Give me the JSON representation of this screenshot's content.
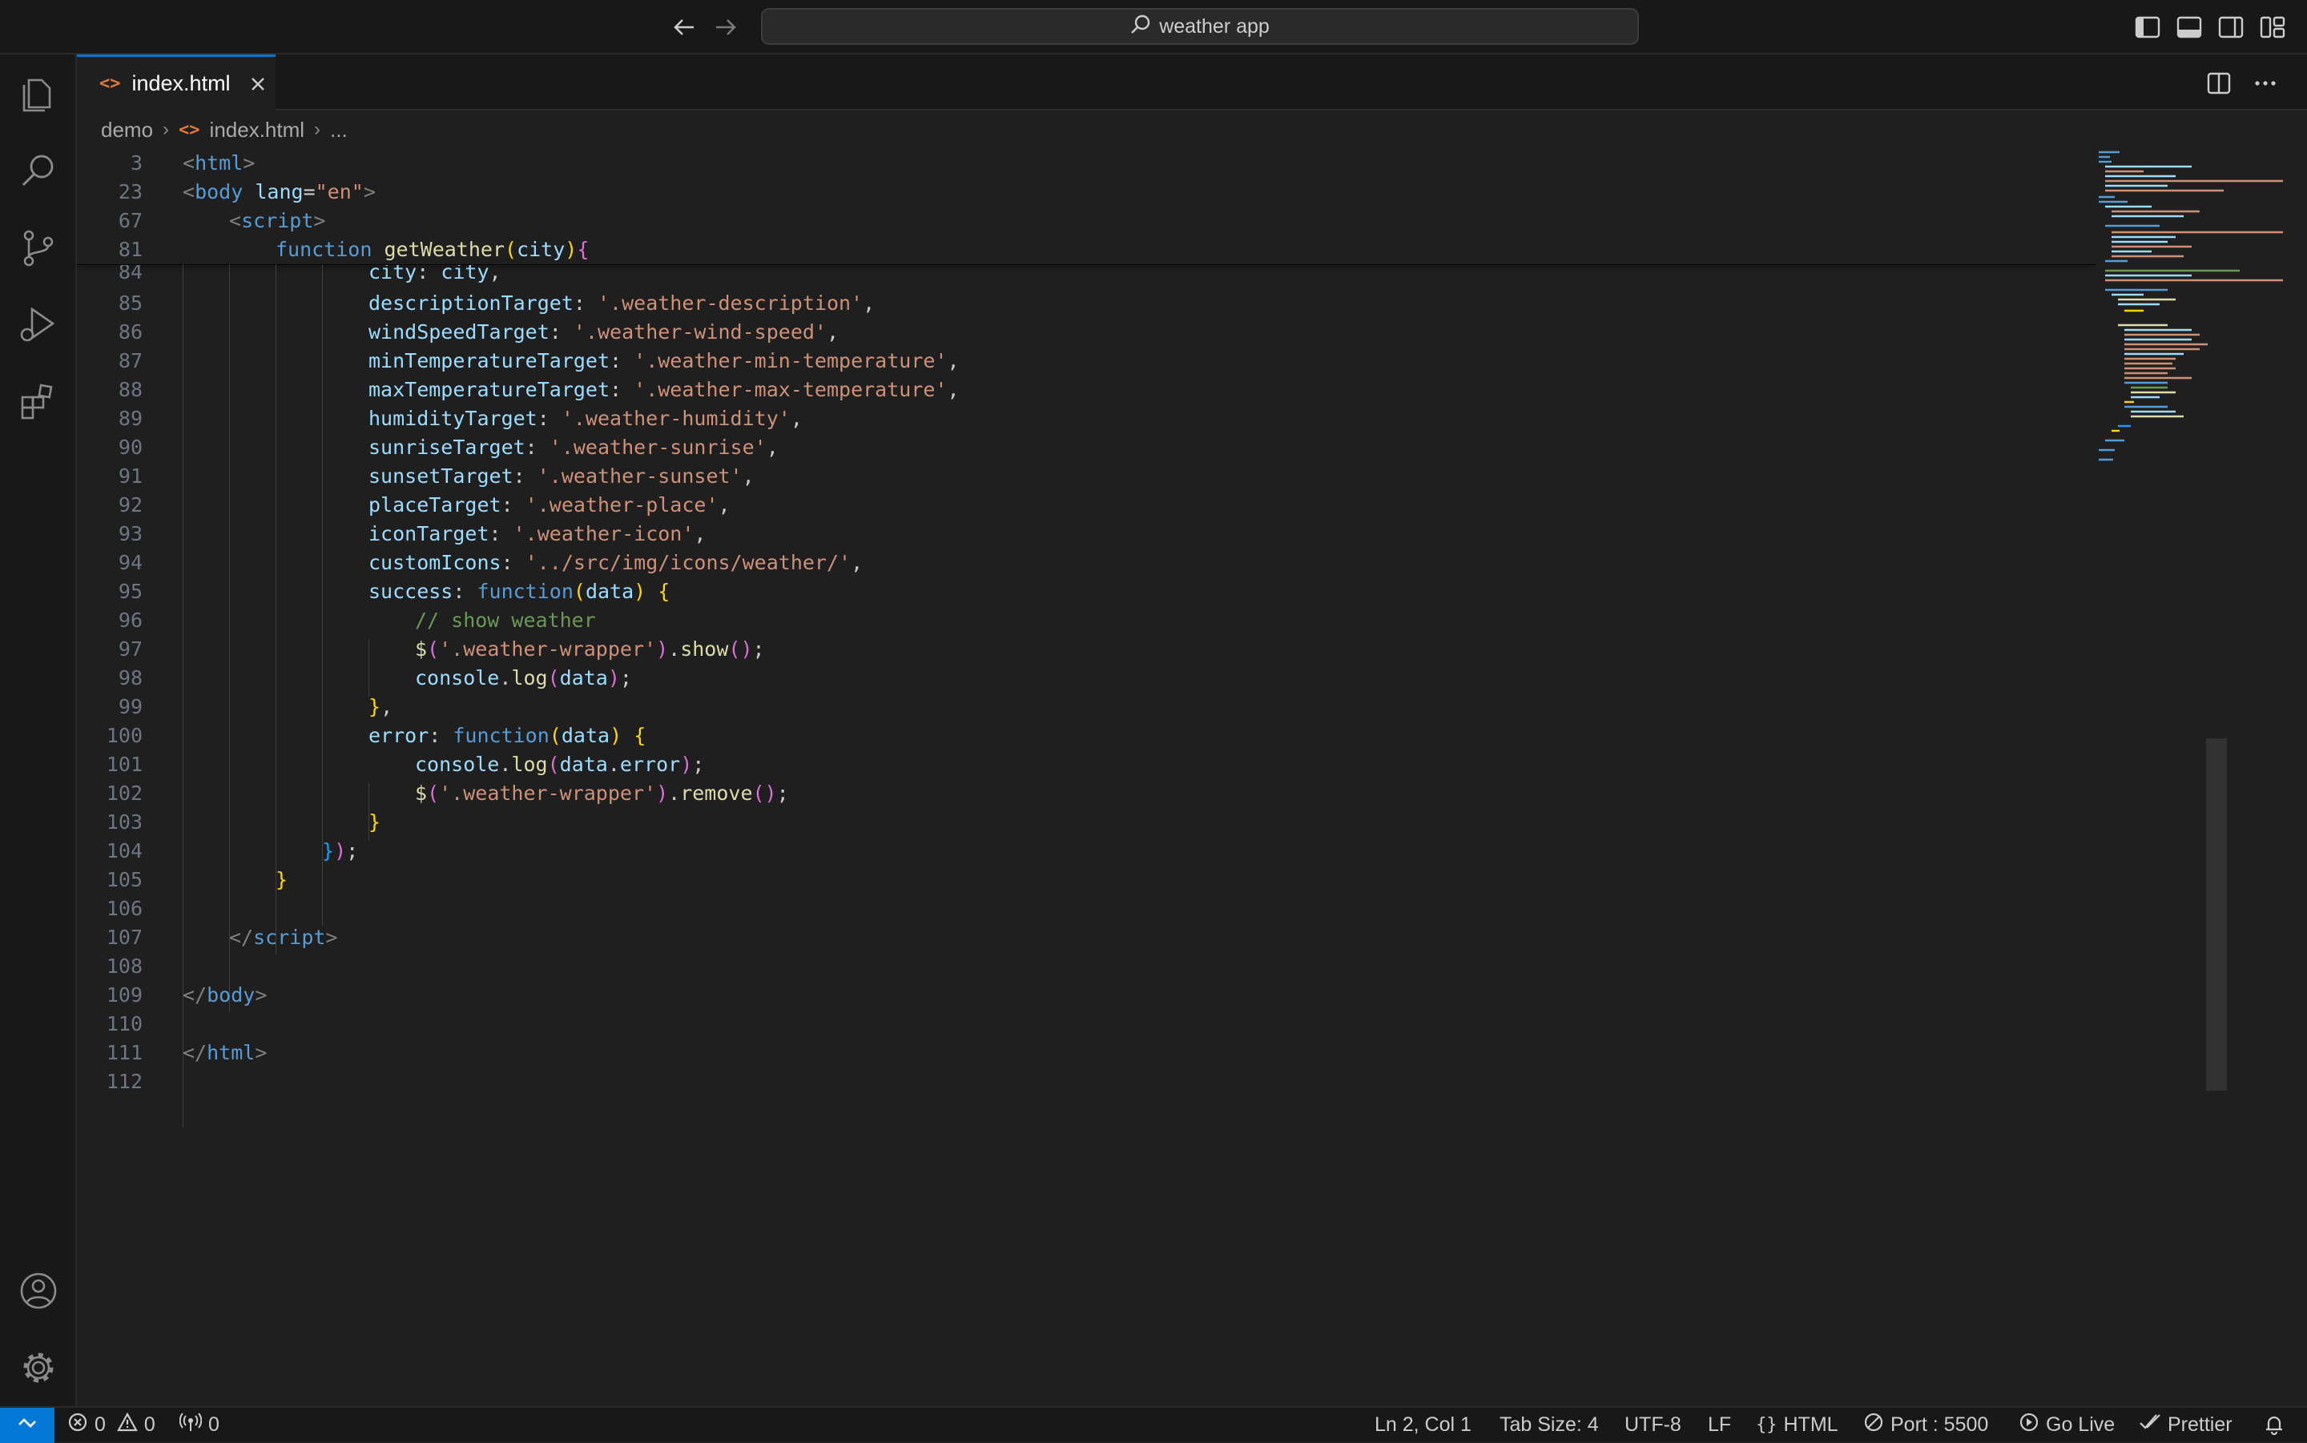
{
  "titlebar": {
    "search_text": "weather app",
    "icons": [
      "arrow-left-icon",
      "arrow-right-icon",
      "search-icon",
      "toggle-primary-sidebar-icon",
      "toggle-panel-icon",
      "toggle-secondary-sidebar-icon",
      "customize-layout-icon"
    ]
  },
  "activity_bar": {
    "icons": [
      "explorer-icon",
      "search-icon",
      "source-control-icon",
      "run-debug-icon",
      "extensions-icon",
      "accounts-icon",
      "manage-gear-icon"
    ]
  },
  "tabs": [
    {
      "label": "index.html",
      "active": true
    }
  ],
  "breadcrumb": {
    "folder": "demo",
    "file": "index.html",
    "more": "..."
  },
  "sticky_lines": [
    {
      "n": "3"
    },
    {
      "n": "23"
    },
    {
      "n": "67"
    },
    {
      "n": "81"
    }
  ],
  "code_lines": [
    {
      "n": "84"
    },
    {
      "n": "85"
    },
    {
      "n": "86"
    },
    {
      "n": "87"
    },
    {
      "n": "88"
    },
    {
      "n": "89"
    },
    {
      "n": "90"
    },
    {
      "n": "91"
    },
    {
      "n": "92"
    },
    {
      "n": "93"
    },
    {
      "n": "94"
    },
    {
      "n": "95"
    },
    {
      "n": "96"
    },
    {
      "n": "97"
    },
    {
      "n": "98"
    },
    {
      "n": "99"
    },
    {
      "n": "100"
    },
    {
      "n": "101"
    },
    {
      "n": "102"
    },
    {
      "n": "103"
    },
    {
      "n": "104"
    },
    {
      "n": "105"
    },
    {
      "n": "106"
    },
    {
      "n": "107"
    },
    {
      "n": "108"
    },
    {
      "n": "109"
    },
    {
      "n": "110"
    },
    {
      "n": "111"
    },
    {
      "n": "112"
    }
  ],
  "code_text": {
    "html_tag": "html",
    "body_tag": "body",
    "lang_attr": "lang",
    "lang_val": "\"en\"",
    "script_tag": "script",
    "function_kw": "function",
    "getweather": "getWeather",
    "city_param": "city",
    "city_prop": "city",
    "city_val": "city",
    "description_prop": "descriptionTarget",
    "description_val": "'.weather-description'",
    "wind_prop": "windSpeedTarget",
    "wind_val": "'.weather-wind-speed'",
    "min_prop": "minTemperatureTarget",
    "min_val": "'.weather-min-temperature'",
    "max_prop": "maxTemperatureTarget",
    "max_val": "'.weather-max-temperature'",
    "humidity_prop": "humidityTarget",
    "humidity_val": "'.weather-humidity'",
    "sunrise_prop": "sunriseTarget",
    "sunrise_val": "'.weather-sunrise'",
    "sunset_prop": "sunsetTarget",
    "sunset_val": "'.weather-sunset'",
    "place_prop": "placeTarget",
    "place_val": "'.weather-place'",
    "icon_prop": "iconTarget",
    "icon_val": "'.weather-icon'",
    "custom_prop": "customIcons",
    "custom_val": "'../src/img/icons/weather/'",
    "success_prop": "success",
    "data_param": "data",
    "comment": "// show weather",
    "wrapper_sel": "'.weather-wrapper'",
    "show_fn": "show",
    "console": "console",
    "log_fn": "log",
    "data_var": "data",
    "error_prop": "error",
    "error_field": "error",
    "remove_fn": "remove"
  },
  "statusbar": {
    "errors": "0",
    "warnings": "0",
    "ports": "0",
    "cursor": "Ln 2, Col 1",
    "tab_size": "Tab Size: 4",
    "encoding": "UTF-8",
    "eol": "LF",
    "language": "HTML",
    "port": "Port : 5500",
    "go_live": "Go Live",
    "prettier": "Prettier"
  },
  "colors": {
    "accent": "#0078d4",
    "editor_bg": "#1f1f1f",
    "chrome_bg": "#181818",
    "string": "#ce9178",
    "keyword": "#569cd6",
    "property": "#9cdcfe",
    "function": "#dcdcaa",
    "comment": "#6a9955"
  }
}
